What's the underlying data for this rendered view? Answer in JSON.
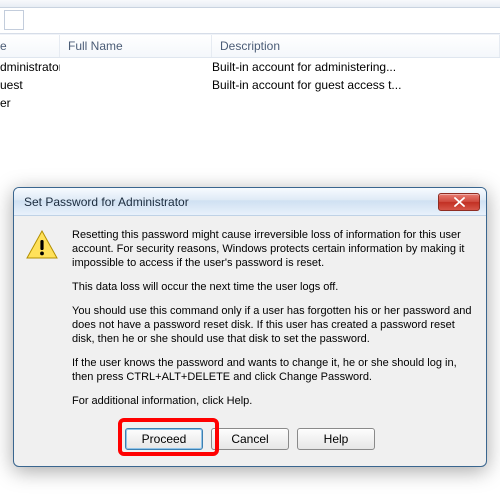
{
  "table": {
    "headers": [
      "e",
      "Full Name",
      "Description"
    ],
    "rows": [
      {
        "name": "dministrator",
        "full_name": "",
        "description": "Built-in account for administering..."
      },
      {
        "name": "uest",
        "full_name": "",
        "description": "Built-in account for guest access t..."
      },
      {
        "name": "er",
        "full_name": "",
        "description": ""
      }
    ]
  },
  "dialog": {
    "title": "Set Password for Administrator",
    "paragraphs": [
      "Resetting this password might cause irreversible loss of information for this user account. For security reasons, Windows protects certain information by making it impossible to access if the user's password is reset.",
      "This data loss will occur the next time the user logs off.",
      "You should use this command only if a user has forgotten his or her password and does not have a password reset disk. If this user has created a password reset disk, then he or she should use that disk to set the password.",
      "If the user knows the password and wants to change it, he or she should log in, then press CTRL+ALT+DELETE and click Change Password.",
      "For additional information, click Help."
    ],
    "buttons": {
      "proceed": "Proceed",
      "cancel": "Cancel",
      "help": "Help"
    }
  }
}
